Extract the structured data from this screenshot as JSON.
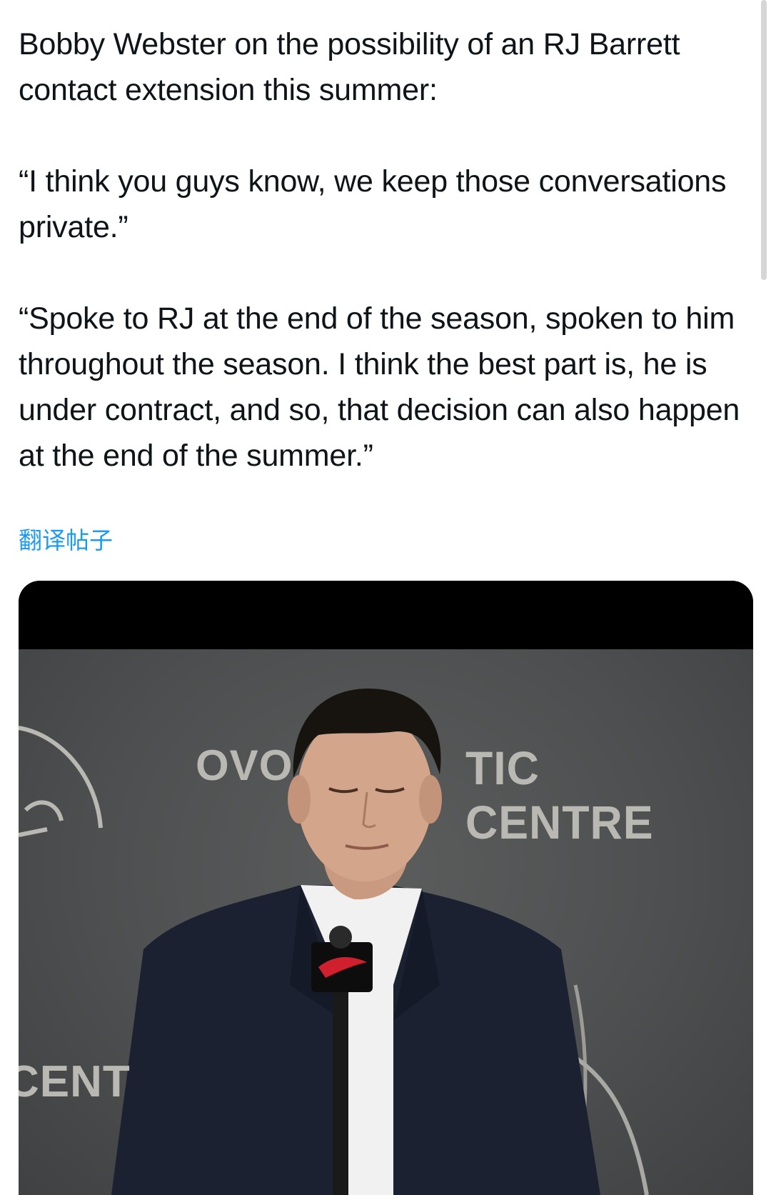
{
  "post": {
    "paragraphs": [
      "Bobby Webster on the possibility of an RJ Barrett contact extension this summer:",
      "“I think you guys know, we keep those conversations private.”",
      "“Spoke to RJ at the end of the season, spoken to him throughout the season. I think the best part is, he is under contract, and so, that decision can also happen at the end of the summer.”"
    ],
    "translate_label": "翻译帖子"
  },
  "media": {
    "backdrop": {
      "left_text": "OVO",
      "right_text": "TIC CENTRE",
      "lower_text": "CENT"
    }
  },
  "colors": {
    "text": "#0f1419",
    "link": "#1d9bf0",
    "backdrop": "#4f5152"
  }
}
